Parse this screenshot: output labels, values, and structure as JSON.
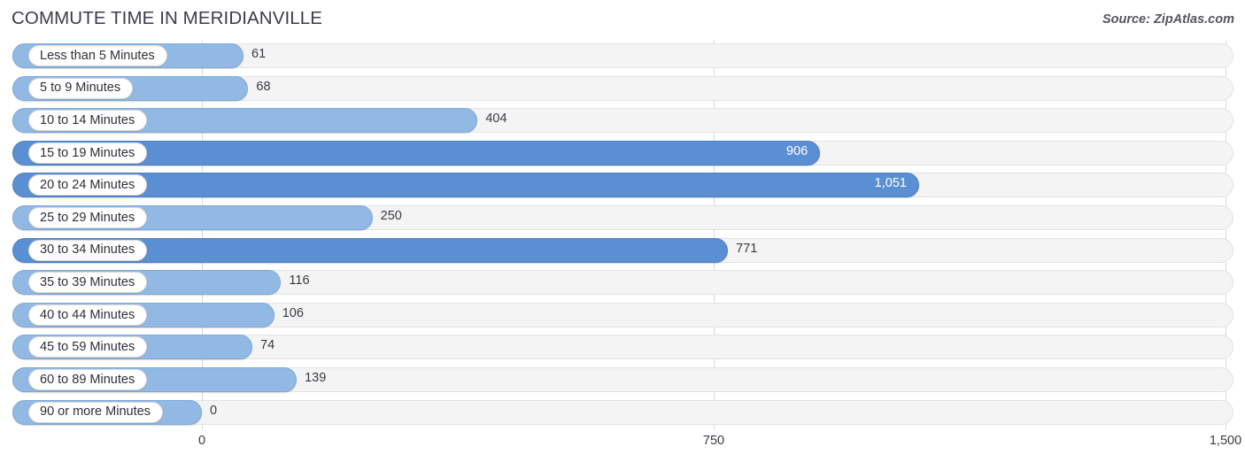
{
  "header": {
    "title": "COMMUTE TIME IN MERIDIANVILLE",
    "source": "Source: ZipAtlas.com"
  },
  "colors": {
    "bar_light": "#92b9e4",
    "bar_dark": "#5b8fd4",
    "track": "#f4f4f4",
    "gridline": "#d9d9d9",
    "title_text": "#3c3c46",
    "label_text": "#2f2f38",
    "value_inside_text": "#ffffff"
  },
  "chart_data": {
    "type": "bar",
    "orientation": "horizontal",
    "title": "COMMUTE TIME IN MERIDIANVILLE",
    "xlabel": "",
    "ylabel": "",
    "xlim": [
      0,
      1500
    ],
    "grid": true,
    "legend": false,
    "xticks": [
      0,
      750,
      1500
    ],
    "xtick_labels": [
      "0",
      "750",
      "1,500"
    ],
    "categories": [
      "Less than 5 Minutes",
      "5 to 9 Minutes",
      "10 to 14 Minutes",
      "15 to 19 Minutes",
      "20 to 24 Minutes",
      "25 to 29 Minutes",
      "30 to 34 Minutes",
      "35 to 39 Minutes",
      "40 to 44 Minutes",
      "45 to 59 Minutes",
      "60 to 89 Minutes",
      "90 or more Minutes"
    ],
    "values": [
      61,
      68,
      404,
      906,
      1051,
      250,
      771,
      116,
      106,
      74,
      139,
      0
    ],
    "value_labels": [
      "61",
      "68",
      "404",
      "906",
      "1,051",
      "250",
      "771",
      "116",
      "106",
      "74",
      "139",
      "0"
    ]
  },
  "rows": [
    {
      "label": "Less than 5 Minutes",
      "value": 61,
      "value_label": "61",
      "shade": "light",
      "label_inside": false
    },
    {
      "label": "5 to 9 Minutes",
      "value": 68,
      "value_label": "68",
      "shade": "light",
      "label_inside": false
    },
    {
      "label": "10 to 14 Minutes",
      "value": 404,
      "value_label": "404",
      "shade": "light",
      "label_inside": false
    },
    {
      "label": "15 to 19 Minutes",
      "value": 906,
      "value_label": "906",
      "shade": "dark",
      "label_inside": true
    },
    {
      "label": "20 to 24 Minutes",
      "value": 1051,
      "value_label": "1,051",
      "shade": "dark",
      "label_inside": true
    },
    {
      "label": "25 to 29 Minutes",
      "value": 250,
      "value_label": "250",
      "shade": "light",
      "label_inside": false
    },
    {
      "label": "30 to 34 Minutes",
      "value": 771,
      "value_label": "771",
      "shade": "dark",
      "label_inside": false
    },
    {
      "label": "35 to 39 Minutes",
      "value": 116,
      "value_label": "116",
      "shade": "light",
      "label_inside": false
    },
    {
      "label": "40 to 44 Minutes",
      "value": 106,
      "value_label": "106",
      "shade": "light",
      "label_inside": false
    },
    {
      "label": "45 to 59 Minutes",
      "value": 74,
      "value_label": "74",
      "shade": "light",
      "label_inside": false
    },
    {
      "label": "60 to 89 Minutes",
      "value": 139,
      "value_label": "139",
      "shade": "light",
      "label_inside": false
    },
    {
      "label": "90 or more Minutes",
      "value": 0,
      "value_label": "0",
      "shade": "light",
      "label_inside": false
    }
  ]
}
